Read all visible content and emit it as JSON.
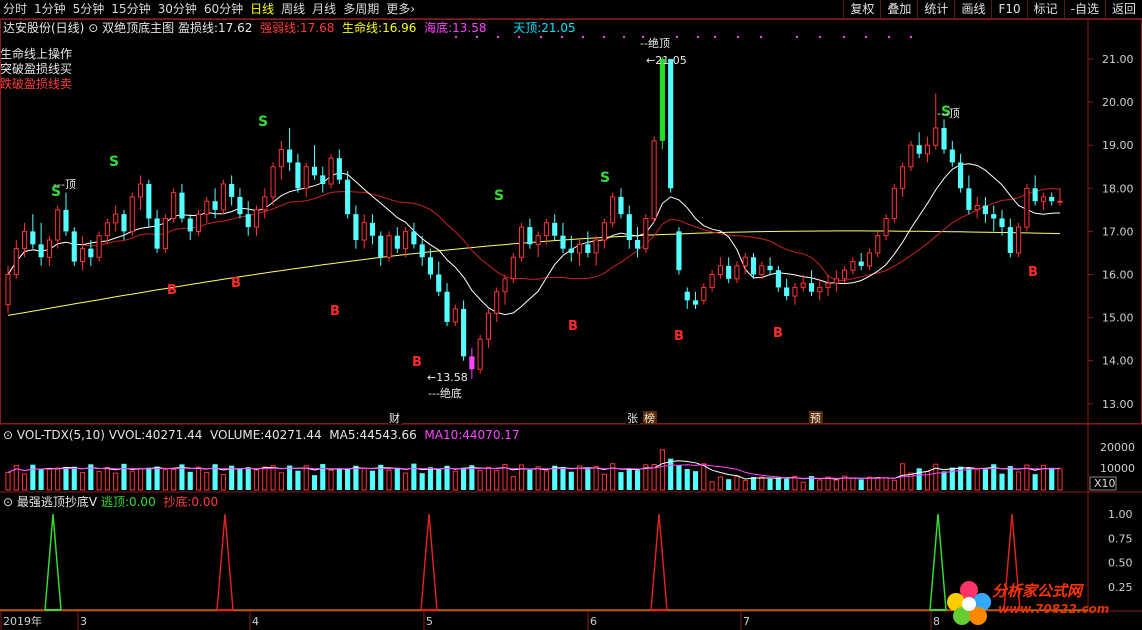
{
  "toolbar": {
    "periods": [
      "分时",
      "1分钟",
      "5分钟",
      "15分钟",
      "30分钟",
      "60分钟",
      "日线",
      "周线",
      "月线",
      "多周期",
      "更多"
    ],
    "active_period": "日线",
    "more_arrow": "›",
    "right_buttons": [
      "复权",
      "叠加",
      "统计",
      "画线",
      "F10",
      "标记",
      "-自选",
      "返回"
    ]
  },
  "main_info": {
    "stock": "达安股份(日线)",
    "indicator": "双绝顶底主图",
    "yingsun_label": "盈损线:",
    "yingsun_value": "17.62",
    "qiangruo_label": "强弱线:",
    "qiangruo_value": "17.68",
    "shengming_label": "生命线:",
    "shengming_value": "16.96",
    "haidi_label": "海底:",
    "haidi_value": "13.58",
    "tianding_label": "天顶:",
    "tianding_value": "21.05"
  },
  "legend": {
    "line1": "生命线上操作",
    "line2": "突破盈损线买",
    "line3": "跌破盈损线卖"
  },
  "price_axis": [
    "21.00",
    "20.00",
    "19.00",
    "18.00",
    "17.00",
    "16.00",
    "15.00",
    "14.00",
    "13.00"
  ],
  "annotations": {
    "top_marker": "--绝顶",
    "top_value": "21.05",
    "bottom_value": "13.58",
    "bottom_marker": "---绝底",
    "left_top": "---顶",
    "right_top": "---顶",
    "signal_s": "S",
    "signal_b": "B",
    "event_cai": "财",
    "event_zhang": "张",
    "event_bang": "榜",
    "event_yu": "预"
  },
  "volume_info": {
    "name": "VOL-TDX(5,10)",
    "vvol_label": "VVOL:",
    "vvol_value": "40271.44",
    "volume_label": "VOLUME:",
    "volume_value": "40271.44",
    "ma5_label": "MA5:",
    "ma5_value": "44543.66",
    "ma10_label": "MA10:",
    "ma10_value": "44070.17",
    "axis": [
      "20000",
      "10000"
    ],
    "unit": "X10"
  },
  "osc_info": {
    "name": "最强逃顶抄底V",
    "escape_label": "逃顶:",
    "escape_value": "0.00",
    "bottom_label": "抄底:",
    "bottom_value": "0.00",
    "axis": [
      "1.00",
      "0.75",
      "0.50",
      "0.25"
    ]
  },
  "date_axis": [
    "2019年",
    "3",
    "4",
    "5",
    "6",
    "7",
    "8"
  ],
  "watermark": {
    "title": "分析家公式网",
    "url": "www.70822.com"
  },
  "colors": {
    "up": "#ff3333",
    "down": "#54ffff",
    "life_line": "#ffff66",
    "loss_line": "#ffffff",
    "strength_line": "#cc2222",
    "top_bar": "#22dd22",
    "bottom_bar": "#ff44ff"
  }
}
